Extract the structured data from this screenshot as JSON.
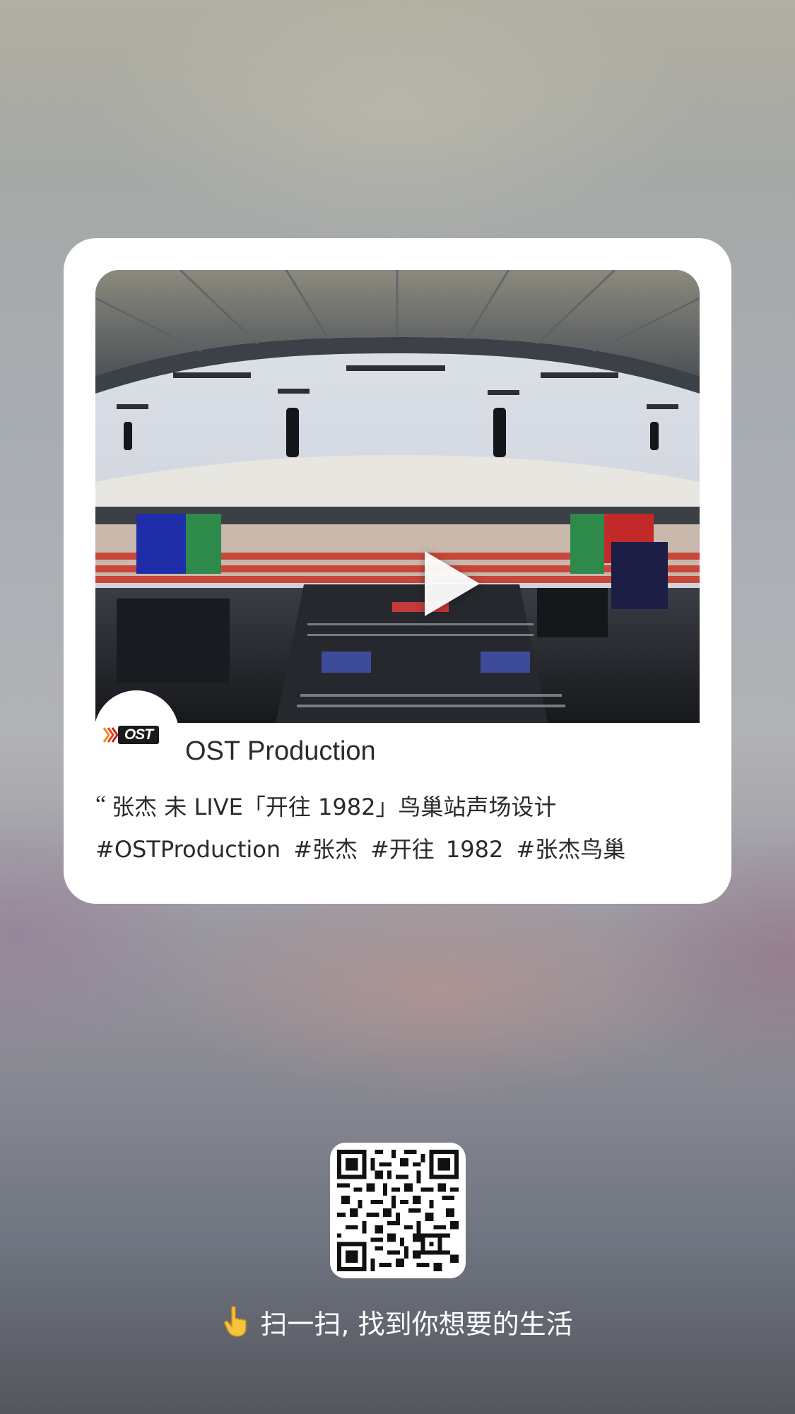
{
  "card": {
    "account_name": "OST Production",
    "logo_text": "OST",
    "quote_mark": "“",
    "title": "张杰 未 LIVE「开往 1982」鸟巢站声场设计",
    "tags": [
      "#OSTProduction",
      "#张杰",
      "#开往 1982",
      "#张杰鸟巢"
    ],
    "video_icon": "play-icon"
  },
  "qr": {
    "icon": "qr-code"
  },
  "prompt": {
    "text": "扫一扫, 找到你想要的生活",
    "icon": "pointing-hand-icon"
  },
  "colors": {
    "card_bg": "#ffffff",
    "text": "#2a2a2a",
    "prompt_text": "#ffffff",
    "logo_orange": "#f08a1c"
  }
}
